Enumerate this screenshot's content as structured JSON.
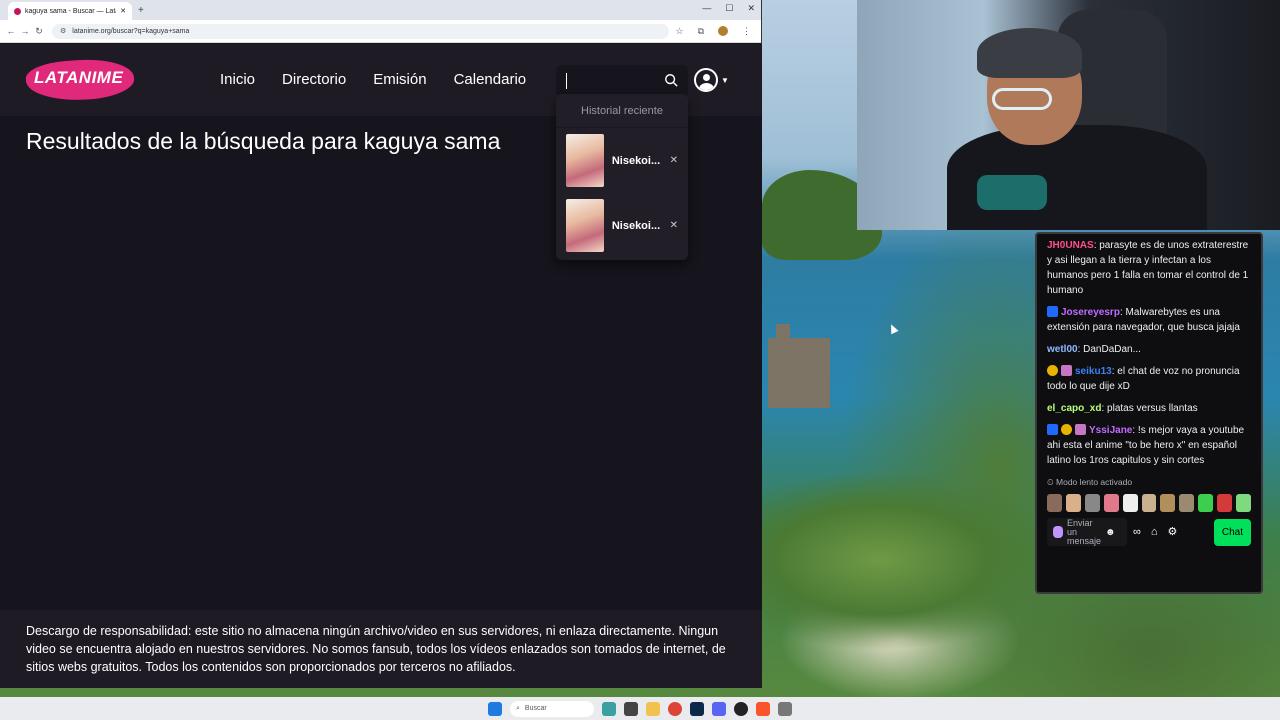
{
  "browser": {
    "tab_title": "kaguya sama - Buscar — Latani",
    "url": "latanime.org/buscar?q=kaguya+sama",
    "win_min": "—",
    "win_max": "☐",
    "win_close": "✕"
  },
  "site": {
    "logo_text": "LATANIME",
    "nav": [
      "Inicio",
      "Directorio",
      "Emisión",
      "Calendario"
    ],
    "search_value": "",
    "results_title": "Resultados de la búsqueda para kaguya sama",
    "dropdown": {
      "header": "Historial reciente",
      "items": [
        {
          "name": "Nisekoi..."
        },
        {
          "name": "Nisekoi..."
        }
      ]
    },
    "footer": "Descargo de responsabilidad: este sitio no almacena ningún archivo/video en sus servidores, ni enlaza directamente. Ningun video se encuentra alojado en nuestros servidores. No somos fansub, todos los vídeos enlazados son tomados de internet, de sitios webs gratuitos. Todos los contenidos son proporcionados por terceros no afiliados."
  },
  "chat": {
    "messages": [
      {
        "user": "JH0UNAS",
        "color": "#ff4f8b",
        "text": ": parasyte es de unos extraterestre y asi llegan a la tierra y infectan a los humanos pero 1 falla en tomar el control de 1 humano"
      },
      {
        "user": "Josereyesrp",
        "color": "#bf6dff",
        "text": ": Malwarebytes es una extensión para navegador, que busca jajaja"
      },
      {
        "user": "wetl00",
        "color": "#8fb8ff",
        "text": ": DanDaDan..."
      },
      {
        "user": "seiku13",
        "color": "#3b82f6",
        "text": ": el chat de voz no pronuncia todo lo que dije xD"
      },
      {
        "user": "el_capo_xd",
        "color": "#b6ff7a",
        "text": ": platas versus llantas"
      },
      {
        "user": "YssiJane",
        "color": "#c26bff",
        "text": ": !s mejor vaya a youtube ahi esta el anime \"to be hero x\" en español latino los 1ros capitulos y sin cortes"
      }
    ],
    "slow_mode": "Modo lento activado",
    "input_placeholder": "Enviar un mensaje",
    "chat_button": "Chat"
  },
  "taskbar": {
    "search_placeholder": "Buscar"
  },
  "colors": {
    "site_bg": "#16141c",
    "header_bg": "#1e1b24",
    "brand_pink": "#e0297a",
    "chat_green": "#00e05a"
  }
}
